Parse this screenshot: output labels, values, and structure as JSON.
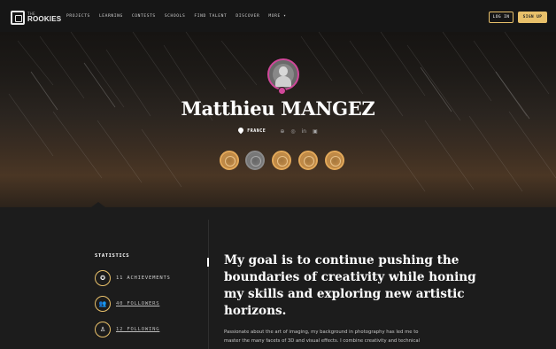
{
  "nav": {
    "logo_small": "THE",
    "logo_name": "ROOKIES",
    "items": [
      "PROJECTS",
      "LEARNING",
      "CONTESTS",
      "SCHOOLS",
      "FIND TALENT",
      "DISCOVER",
      "MORE ▾"
    ],
    "login": "LOG IN",
    "signup": "SIGN UP"
  },
  "profile": {
    "name": "Matthieu MANGEZ",
    "country": "FRANCE",
    "social_icons": [
      "globe-icon",
      "instagram-icon",
      "linkedin-icon",
      "youtube-icon"
    ],
    "badges": [
      "gold",
      "grey",
      "gold",
      "gold",
      "gold"
    ],
    "accent_color": "#d0489a"
  },
  "stats": {
    "title": "STATISTICS",
    "items": [
      {
        "icon": "award-icon",
        "label": "11 ACHIEVEMENTS",
        "link": false
      },
      {
        "icon": "users-icon",
        "label": "40 FOLLOWERS",
        "link": true
      },
      {
        "icon": "user-follow-icon",
        "label": "12 FOLLOWING",
        "link": true
      }
    ]
  },
  "about": {
    "goal": "My goal is to continue pushing the boundaries of creativity while honing my skills and exploring new artistic horizons.",
    "bio_line1": "Passionate about the art of imaging, my background in photography has led me to",
    "bio_line2": "master the many facets of 3D and visual effects. I combine creativity and technical"
  },
  "colors": {
    "gold": "#e8c06a",
    "nav_bg": "#161616",
    "page_bg": "#1c1c1c"
  }
}
